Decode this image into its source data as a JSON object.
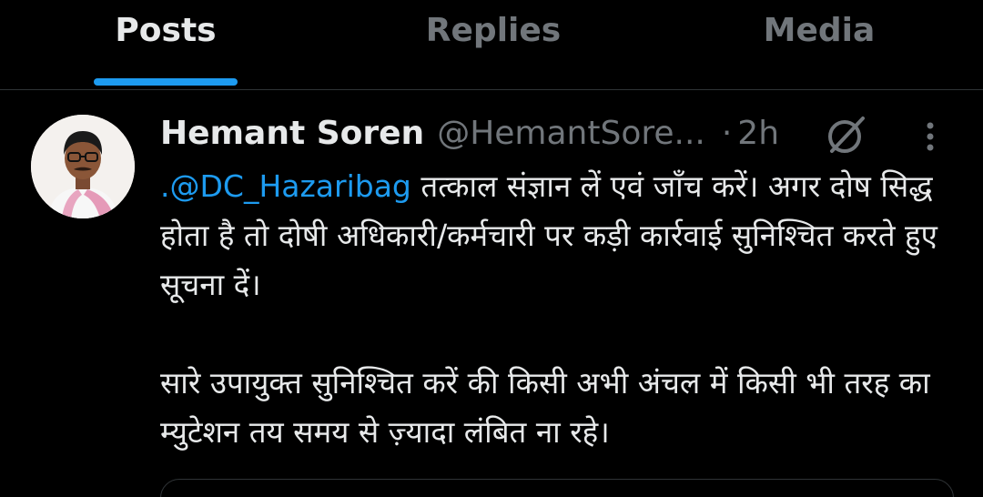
{
  "tabs": [
    {
      "label": "Posts",
      "active": true
    },
    {
      "label": "Replies",
      "active": false
    },
    {
      "label": "Media",
      "active": false
    }
  ],
  "post": {
    "author_name": "Hemant Soren",
    "author_handle": "@HemantSore...",
    "separator": "·",
    "time": "2h",
    "paragraphs": [
      {
        "mention": ".@DC_Hazaribag",
        "text": " तत्काल संज्ञान लें एवं जाँच करें। अगर दोष सिद्ध होता है तो दोषी अधिकारी/कर्मचारी पर कड़ी कार्रवाई सुनिश्चित करते हुए सूचना दें।"
      },
      {
        "mention": "",
        "text": "सारे उपायुक्त सुनिश्चित करें की किसी अभी अंचल में किसी भी तरह का म्युटेशन तय समय से ज़्यादा लंबित ना रहे।"
      }
    ]
  },
  "icons": {
    "grok": "grok-icon",
    "more": "more-vertical-icon"
  },
  "colors": {
    "background": "#000000",
    "text": "#e7e9ea",
    "muted": "#71767b",
    "accent": "#1d9bf0",
    "divider": "#2f3336"
  }
}
